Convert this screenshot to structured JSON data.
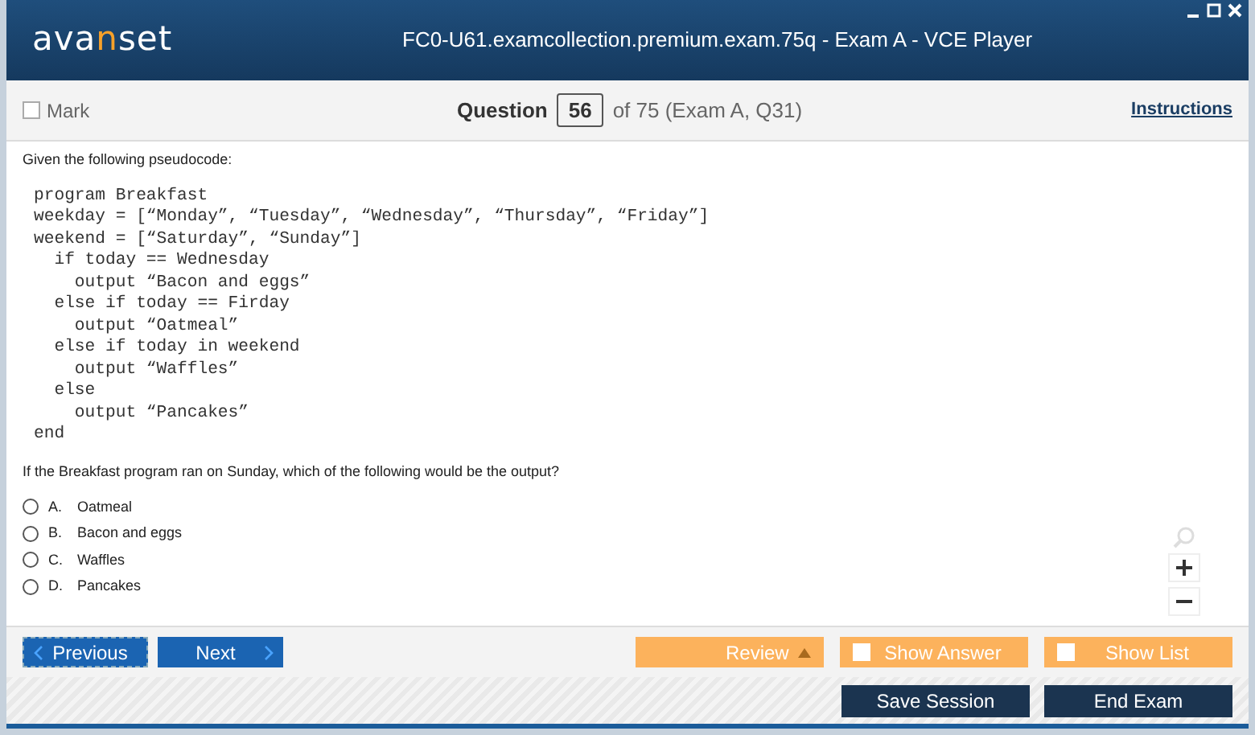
{
  "window": {
    "title": "FC0-U61.examcollection.premium.exam.75q - Exam A - VCE Player"
  },
  "logo": [
    {
      "text": "ava",
      "accent": false
    },
    {
      "text": "n",
      "accent": true
    },
    {
      "text": "set",
      "accent": false
    }
  ],
  "toolbar": {
    "mark": {
      "label": "Mark",
      "checked": false
    },
    "question_label": "Question",
    "question_number": "56",
    "question_of": "of 75 (Exam A, Q31)",
    "instructions": "Instructions"
  },
  "question": {
    "intro": "Given the following pseudocode:",
    "code": [
      "program Breakfast",
      "weekday = [“Monday”, “Tuesday”, “Wednesday”, “Thursday”, “Friday”]",
      "weekend = [“Saturday”, “Sunday”]",
      "  if today == Wednesday",
      "    output “Bacon and eggs”",
      "  else if today == Firday",
      "    output “Oatmeal”",
      "  else if today in weekend",
      "    output “Waffles”",
      "  else",
      "    output “Pancakes”",
      "end"
    ],
    "prompt": "If the Breakfast program ran on Sunday, which of the following would be the output?",
    "options": [
      {
        "letter": "A.",
        "text": "Oatmeal",
        "selected": false
      },
      {
        "letter": "B.",
        "text": "Bacon and eggs",
        "selected": false
      },
      {
        "letter": "C.",
        "text": "Waffles",
        "selected": false
      },
      {
        "letter": "D.",
        "text": "Pancakes",
        "selected": false
      }
    ]
  },
  "nav": {
    "previous": "Previous",
    "next": "Next",
    "review": "Review",
    "show_answer": {
      "label": "Show Answer",
      "checked": false
    },
    "show_list": {
      "label": "Show List",
      "checked": false
    }
  },
  "footer": {
    "save": "Save Session",
    "end": "End Exam"
  }
}
